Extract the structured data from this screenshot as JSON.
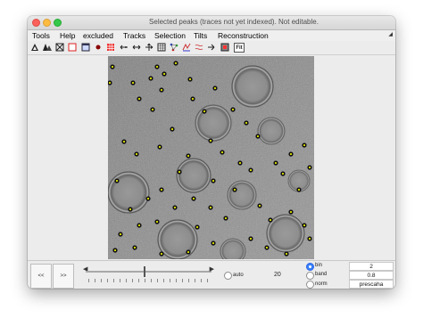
{
  "window": {
    "title": "Selected peaks (traces not yet indexed). Not editable."
  },
  "menubar": {
    "items": [
      "Tools",
      "Help",
      "excluded",
      "Tracks",
      "Selection",
      "Tilts",
      "Reconstruction"
    ]
  },
  "toolbar": {
    "fit_label": "Fit"
  },
  "controls": {
    "prev_label": "<<",
    "next_label": ">>",
    "auto_label": "auto",
    "frame_value": "20",
    "bin_label": "bin",
    "bin_value": "2",
    "band_label": "band",
    "band_value": "0.8",
    "norm_label": "norm",
    "norm_value": "prescaha"
  },
  "colors": {
    "marker": "#e3e600",
    "marker_dark": "#111111",
    "radio_selected": "#3b82f6"
  }
}
